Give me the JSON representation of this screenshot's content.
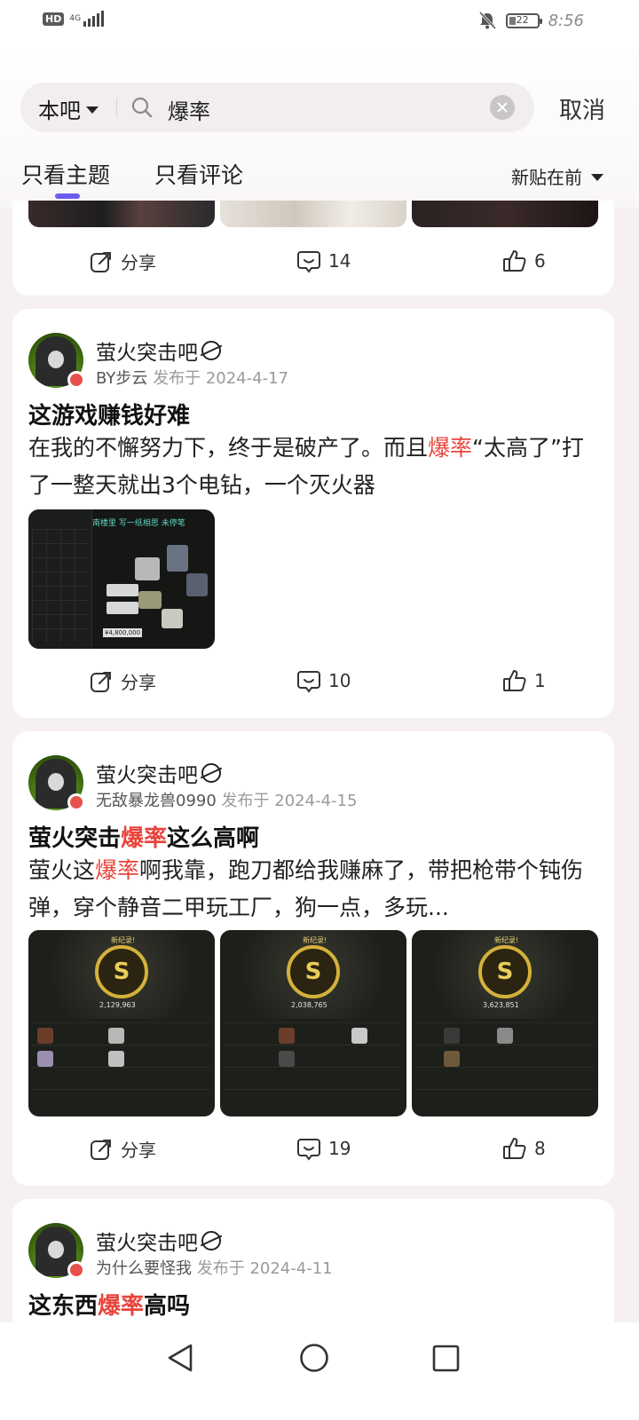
{
  "status_bar": {
    "hd": "HD",
    "network": "4G",
    "time": "8:56",
    "battery_level": "22"
  },
  "search": {
    "scope": "本吧",
    "query": "爆率",
    "cancel": "取消"
  },
  "tabs": [
    {
      "label": "只看主题"
    },
    {
      "label": "只看评论"
    }
  ],
  "sort": {
    "label": "新贴在前"
  },
  "top_card": {
    "share": "分享",
    "comments": "14",
    "likes": "6"
  },
  "posts": [
    {
      "forum": "萤火突击吧",
      "author": "BY步云",
      "date": "发布于 2024-4-17",
      "title": "这游戏赚钱好难",
      "body_before": "在我的不懈努力下，终于是破产了。而且",
      "body_hl": "爆率",
      "body_after": "“太高了”打了一整天就出3个电钻，一个灭火器",
      "share": "分享",
      "comments": "10",
      "likes": "1",
      "thumbs": [
        {
          "caption": "南楼里 写一纸相思 未停笔",
          "price": "¥4,800,000"
        }
      ]
    },
    {
      "forum": "萤火突击吧",
      "author": "无敌暴龙兽0990",
      "date": "发布于 2024-4-15",
      "title_before": "萤火突击",
      "title_hl": "爆率",
      "title_after": "这么高啊",
      "body_before": "萤火这",
      "body_hl": "爆率",
      "body_after": "啊我靠，跑刀都给我赚麻了，带把枪带个钝伤弹，穿个静音二甲玩工厂，狗一点，多玩...",
      "share": "分享",
      "comments": "19",
      "likes": "8",
      "thumbs": [
        {
          "badge": "新纪录!",
          "amount": "2,129,963"
        },
        {
          "badge": "新纪录!",
          "amount": "2,038,765"
        },
        {
          "badge": "新纪录!",
          "amount": "3,623,851"
        }
      ]
    },
    {
      "forum": "萤火突击吧",
      "author": "为什么要怪我",
      "date": "发布于 2024-4-11",
      "title_before": "这东西",
      "title_hl": "爆率",
      "title_after": "高吗"
    }
  ],
  "colors": {
    "highlight": "#e8453c",
    "tab_indicator": "#6b5cf0",
    "background": "#f6f0f4"
  }
}
